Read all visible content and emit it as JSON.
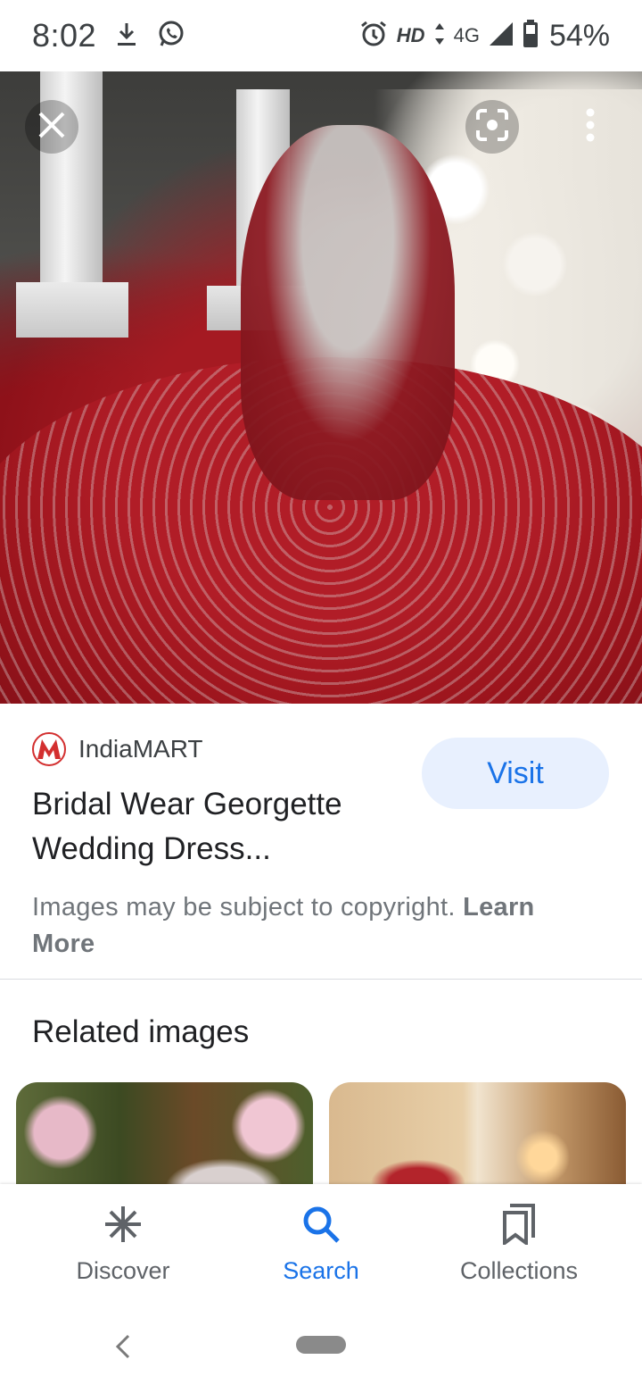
{
  "status_bar": {
    "time": "8:02",
    "hd": "HD",
    "network": "4G",
    "battery": "54%",
    "icons": [
      "download-icon",
      "whatsapp-icon",
      "alarm-icon",
      "data-arrows-icon",
      "signal-icon",
      "battery-icon"
    ]
  },
  "viewer": {
    "icons": [
      "close-icon",
      "lens-icon",
      "more-vert-icon"
    ]
  },
  "result": {
    "source_name": "IndiaMART",
    "source_logo_color": "#d32f2f",
    "title": "Bridal Wear Georgette Wedding Dress...",
    "visit_label": "Visit",
    "copyright_text": "Images may be subject to copyright. ",
    "learn_more": "Learn More"
  },
  "related": {
    "title": "Related images"
  },
  "bottom_nav": {
    "items": [
      {
        "label": "Discover",
        "icon": "discover-asterisk-icon"
      },
      {
        "label": "Search",
        "icon": "search-icon",
        "active": true
      },
      {
        "label": "Collections",
        "icon": "collections-icon"
      }
    ]
  },
  "colors": {
    "accent": "#1a73e8",
    "visit_bg": "#e8f0fe",
    "text_primary": "#202124",
    "text_secondary": "#70757a"
  }
}
